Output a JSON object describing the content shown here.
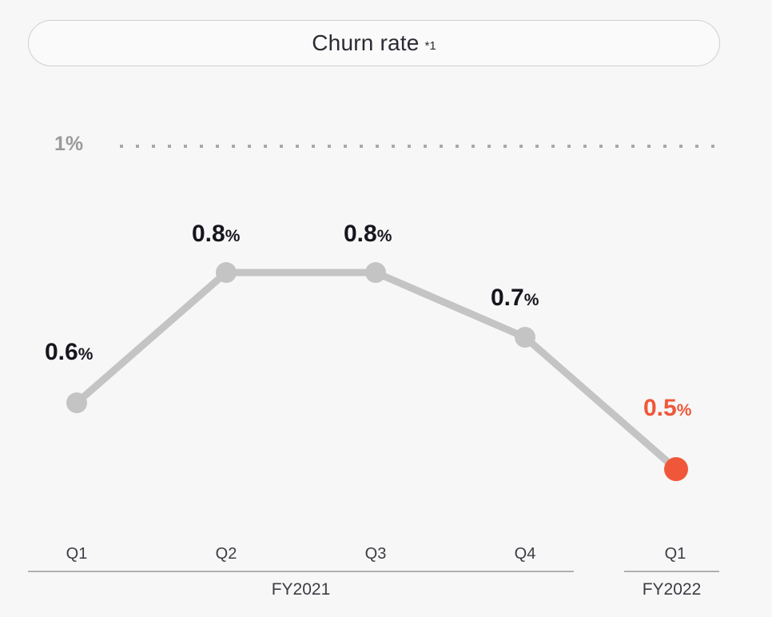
{
  "header": {
    "title": "Churn rate",
    "footnote_marker": "*1"
  },
  "chart_data": {
    "type": "line",
    "title": "Churn rate *1",
    "xlabel": "",
    "ylabel": "",
    "ylim": [
      0,
      1
    ],
    "grid": true,
    "legend_position": "none",
    "gridlines": [
      {
        "value": 1,
        "label": "1%",
        "style": "dotted",
        "color": "#a8a8a8"
      }
    ],
    "categories": [
      "Q1",
      "Q2",
      "Q3",
      "Q4",
      "Q1"
    ],
    "group_labels": [
      {
        "label": "FY2021",
        "categories": [
          "Q1",
          "Q2",
          "Q3",
          "Q4"
        ]
      },
      {
        "label": "FY2022",
        "categories": [
          "Q1"
        ]
      }
    ],
    "series": [
      {
        "name": "Churn rate",
        "values": [
          0.6,
          0.8,
          0.8,
          0.7,
          0.5
        ],
        "value_labels": [
          "0.6%",
          "0.8%",
          "0.8%",
          "0.7%",
          "0.5%"
        ],
        "line_color": "#c4c4c4",
        "marker_color": "#c4c4c4",
        "highlight_index": 4,
        "highlight_color": "#f0573a"
      }
    ],
    "points": [
      {
        "period": "FY2021",
        "quarter": "Q1",
        "value": 0.6,
        "label": "0.6%",
        "highlighted": false
      },
      {
        "period": "FY2021",
        "quarter": "Q2",
        "value": 0.8,
        "label": "0.8%",
        "highlighted": false
      },
      {
        "period": "FY2021",
        "quarter": "Q3",
        "value": 0.8,
        "label": "0.8%",
        "highlighted": false
      },
      {
        "period": "FY2021",
        "quarter": "Q4",
        "value": 0.7,
        "label": "0.7%",
        "highlighted": false
      },
      {
        "period": "FY2022",
        "quarter": "Q1",
        "value": 0.5,
        "label": "0.5%",
        "highlighted": true
      }
    ]
  },
  "axis": {
    "ticks": [
      "Q1",
      "Q2",
      "Q3",
      "Q4",
      "Q1"
    ],
    "fy2021": "FY2021",
    "fy2022": "FY2022"
  },
  "value_labels": {
    "q1_num": "0.6",
    "q1_pct": "%",
    "q2_num": "0.8",
    "q2_pct": "%",
    "q3_num": "0.8",
    "q3_pct": "%",
    "q4_num": "0.7",
    "q4_pct": "%",
    "q1b_num": "0.5",
    "q1b_pct": "%"
  },
  "gridline": {
    "label": "1%"
  },
  "colors": {
    "background": "#f7f7f7",
    "line": "#c4c4c4",
    "accent": "#f0573a",
    "text_dark": "#16161e",
    "text_muted": "#9a9a9a",
    "axis": "#b0b0b0",
    "pill_border": "#cfcfcf"
  }
}
